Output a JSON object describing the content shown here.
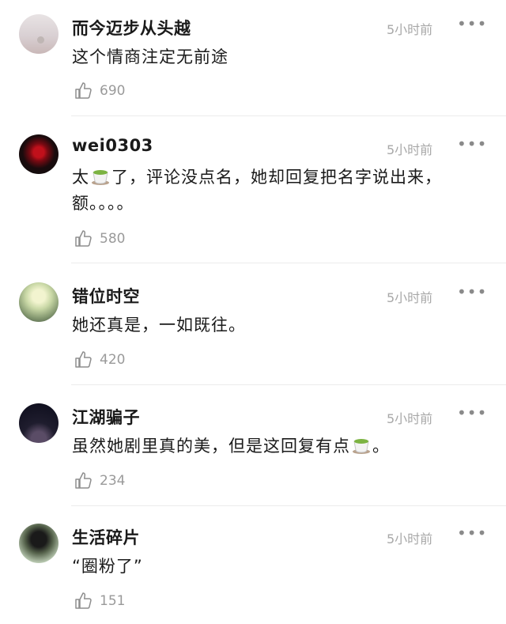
{
  "comments": [
    {
      "username": "而今迈步从头越",
      "time": "5小时前",
      "more": "•••",
      "text": "这个情商注定无前途",
      "likes": "690"
    },
    {
      "username": "wei0303",
      "time": "5小时前",
      "more": "•••",
      "text_part1": "太",
      "text_part2": "了，评论没点名，她却回复把名字说出来，额。。。。",
      "likes": "580"
    },
    {
      "username": "错位时空",
      "time": "5小时前",
      "more": "•••",
      "text": "她还真是，一如既往。",
      "likes": "420"
    },
    {
      "username": "江湖骗子",
      "time": "5小时前",
      "more": "•••",
      "text_part1": "虽然她剧里真的美，但是这回复有点",
      "text_part2": "。",
      "likes": "234"
    },
    {
      "username": "生活碎片",
      "time": "5小时前",
      "more": "•••",
      "text": "“圈粉了”",
      "likes": "151"
    }
  ],
  "icons": {
    "like": "thumbs-up-icon",
    "emoji": "tea-cup-icon",
    "more": "more-dots-icon"
  }
}
